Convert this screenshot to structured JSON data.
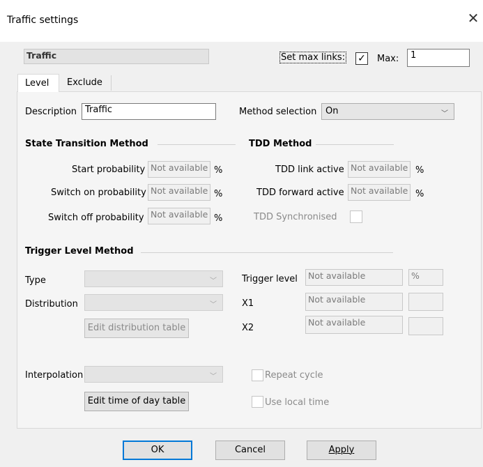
{
  "window": {
    "title": "Traffic settings",
    "close_glyph": "✕"
  },
  "header": {
    "name_field": "Traffic",
    "set_max_links_label": "Set max links:",
    "set_max_links_checked": true,
    "max_label": "Max:",
    "max_value": "1"
  },
  "tabs": [
    {
      "label": "Level",
      "active": true
    },
    {
      "label": "Exclude",
      "active": false
    }
  ],
  "description": {
    "label": "Description",
    "value": "Traffic"
  },
  "method_selection": {
    "label": "Method selection",
    "value": "On"
  },
  "state_transition": {
    "title": "State Transition Method",
    "rows": [
      {
        "label": "Start probability",
        "value": "Not available",
        "unit": "%"
      },
      {
        "label": "Switch on probability",
        "value": "Not available",
        "unit": "%"
      },
      {
        "label": "Switch off probability",
        "value": "Not available",
        "unit": "%"
      }
    ]
  },
  "tdd": {
    "title": "TDD Method",
    "rows": [
      {
        "label": "TDD link active",
        "value": "Not available",
        "unit": "%"
      },
      {
        "label": "TDD forward active",
        "value": "Not available",
        "unit": "%"
      }
    ],
    "synchronised_label": "TDD Synchronised"
  },
  "trigger": {
    "title": "Trigger Level Method",
    "type_label": "Type",
    "distribution_label": "Distribution",
    "edit_distribution_button": "Edit distribution table",
    "trigger_level_label": "Trigger level",
    "trigger_level_value": "Not available",
    "trigger_level_unit": "%",
    "x1_label": "X1",
    "x1_value": "Not available",
    "x2_label": "X2",
    "x2_value": "Not available"
  },
  "interpolation": {
    "label": "Interpolation",
    "edit_time_button": "Edit time of day table",
    "repeat_cycle_label": "Repeat cycle",
    "use_local_time_label": "Use local time"
  },
  "footer": {
    "ok": "OK",
    "cancel": "Cancel",
    "apply": "Apply"
  },
  "icons": {
    "check": "✓",
    "chevron": "﹀"
  }
}
